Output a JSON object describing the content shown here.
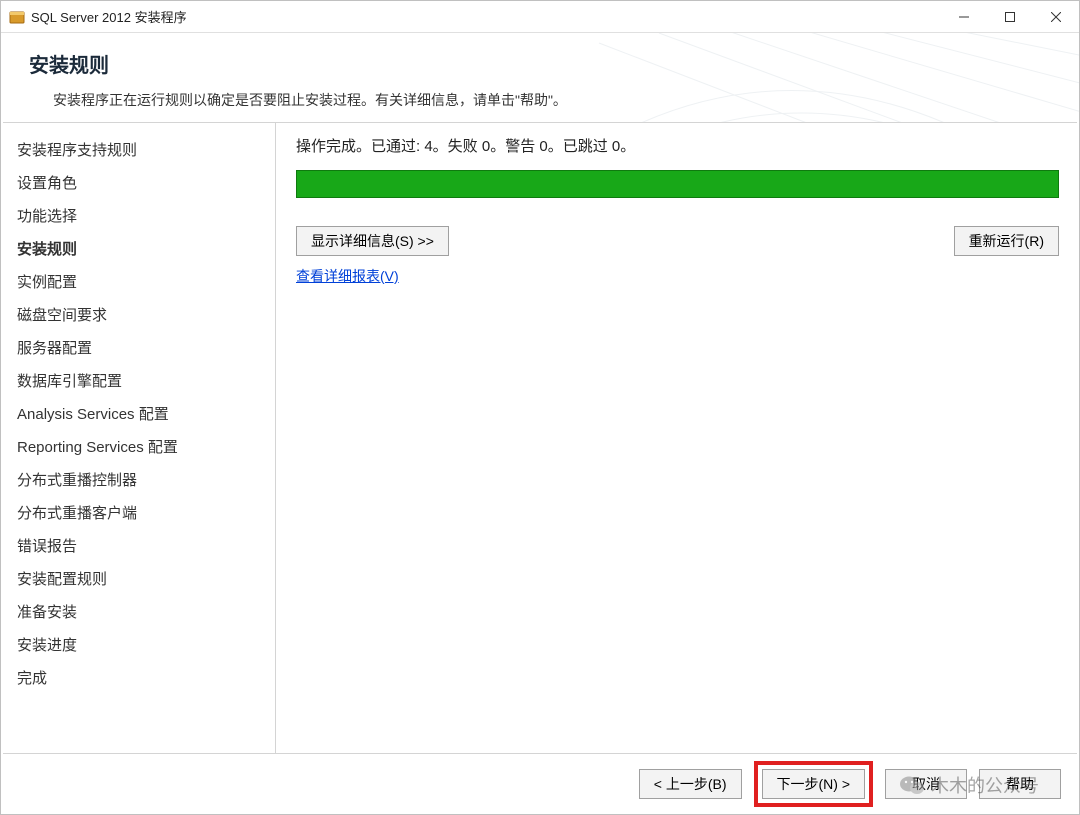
{
  "window": {
    "title": "SQL Server 2012 安装程序"
  },
  "header": {
    "title": "安装规则",
    "subtitle": "安装程序正在运行规则以确定是否要阻止安装过程。有关详细信息，请单击\"帮助\"。"
  },
  "sidebar": {
    "steps": [
      "安装程序支持规则",
      "设置角色",
      "功能选择",
      "安装规则",
      "实例配置",
      "磁盘空间要求",
      "服务器配置",
      "数据库引擎配置",
      "Analysis Services 配置",
      "Reporting Services 配置",
      "分布式重播控制器",
      "分布式重播客户端",
      "错误报告",
      "安装配置规则",
      "准备安装",
      "安装进度",
      "完成"
    ],
    "active_index": 3
  },
  "main": {
    "status_text": "操作完成。已通过: 4。失败 0。警告 0。已跳过 0。",
    "show_details_label": "显示详细信息(S) >>",
    "rerun_label": "重新运行(R)",
    "view_report_label": "查看详细报表(V)"
  },
  "footer": {
    "back_label": "< 上一步(B)",
    "next_label": "下一步(N) >",
    "cancel_label": "取消",
    "help_label": "帮助"
  },
  "watermark": {
    "text": "木木的公众号"
  }
}
